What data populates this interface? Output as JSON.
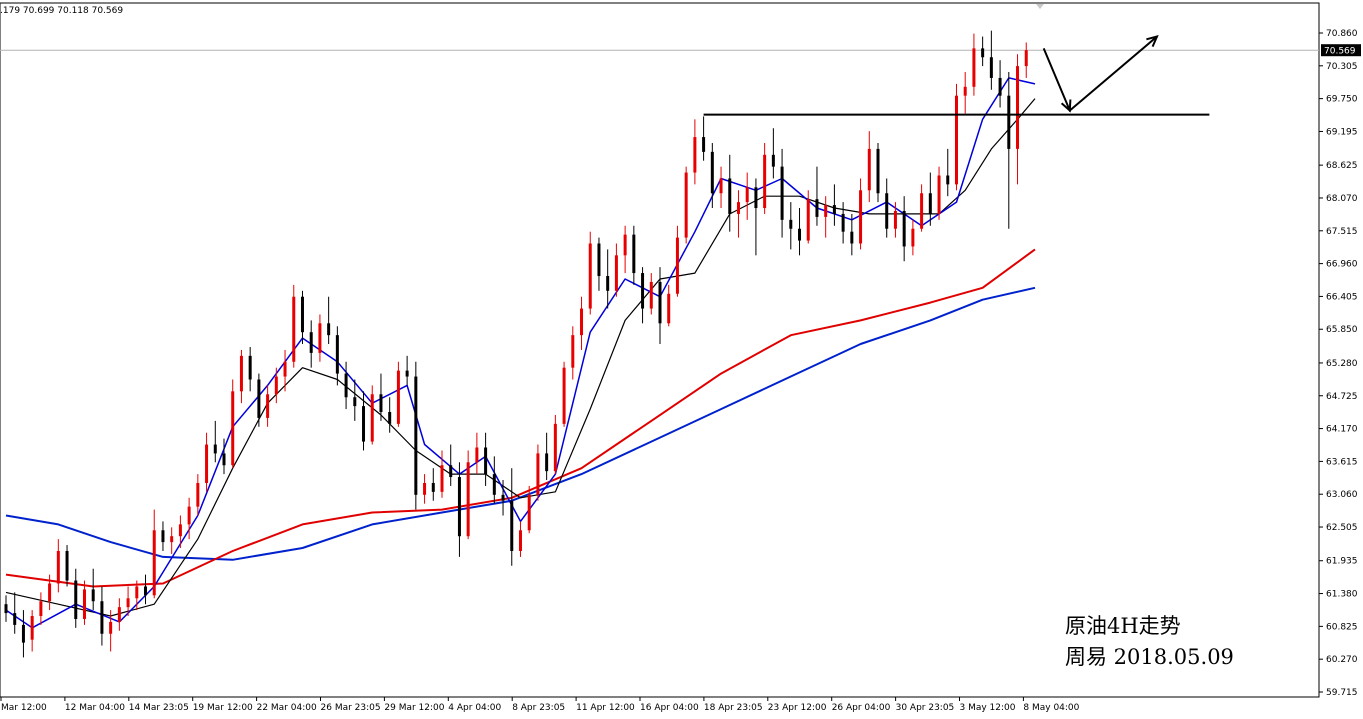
{
  "header": {
    "ohlc_text": ".179 70.699 70.118 70.569"
  },
  "annotation": {
    "title": "原油4H走势",
    "date_line": "周易 2018.05.09"
  },
  "colors": {
    "bull": "#e80000",
    "bear": "#000000",
    "ma_fast": "#0000dd",
    "ma_mid": "#000000",
    "ma_slow_red": "#e00000",
    "ma_slow_blue": "#0022cc",
    "price_line": "#b4b4b4",
    "badge": "#000000"
  },
  "chart_data": {
    "type": "candlestick",
    "y_ticks": [
      "70.860",
      "70.305",
      "69.750",
      "69.195",
      "68.625",
      "68.070",
      "67.515",
      "66.960",
      "66.405",
      "65.850",
      "65.280",
      "64.725",
      "64.170",
      "63.615",
      "63.060",
      "62.505",
      "61.935",
      "61.380",
      "60.825",
      "60.270",
      "59.715"
    ],
    "ylim": [
      59.715,
      70.86
    ],
    "x_ticks": [
      "Mar 12:00",
      "12 Mar 04:00",
      "14 Mar 23:05",
      "19 Mar 12:00",
      "22 Mar 04:00",
      "26 Mar 23:05",
      "29 Mar 12:00",
      "4 Apr 04:00",
      "8 Apr 23:05",
      "11 Apr 12:00",
      "16 Apr 04:00",
      "18 Apr 23:05",
      "23 Apr 12:00",
      "26 Apr 04:00",
      "30 Apr 23:05",
      "3 May 12:00",
      "8 May 04:00"
    ],
    "current_price": 70.569,
    "candles": [
      {
        "o": 61.2,
        "h": 61.35,
        "l": 60.9,
        "c": 61.05
      },
      {
        "o": 61.05,
        "h": 61.4,
        "l": 60.7,
        "c": 60.85
      },
      {
        "o": 60.85,
        "h": 61.1,
        "l": 60.3,
        "c": 60.55
      },
      {
        "o": 60.6,
        "h": 61.1,
        "l": 60.4,
        "c": 61.0
      },
      {
        "o": 61.0,
        "h": 61.4,
        "l": 60.85,
        "c": 61.25
      },
      {
        "o": 61.25,
        "h": 61.7,
        "l": 61.1,
        "c": 61.55
      },
      {
        "o": 61.55,
        "h": 62.3,
        "l": 61.4,
        "c": 62.1
      },
      {
        "o": 62.1,
        "h": 62.2,
        "l": 61.5,
        "c": 61.6
      },
      {
        "o": 61.6,
        "h": 61.8,
        "l": 60.8,
        "c": 60.95
      },
      {
        "o": 60.95,
        "h": 61.6,
        "l": 60.85,
        "c": 61.45
      },
      {
        "o": 61.45,
        "h": 61.8,
        "l": 61.1,
        "c": 61.25
      },
      {
        "o": 61.25,
        "h": 61.5,
        "l": 60.5,
        "c": 60.7
      },
      {
        "o": 60.7,
        "h": 61.1,
        "l": 60.4,
        "c": 60.9
      },
      {
        "o": 60.9,
        "h": 61.3,
        "l": 60.75,
        "c": 61.15
      },
      {
        "o": 61.15,
        "h": 61.5,
        "l": 61.0,
        "c": 61.3
      },
      {
        "o": 61.3,
        "h": 61.6,
        "l": 61.1,
        "c": 61.5
      },
      {
        "o": 61.5,
        "h": 61.7,
        "l": 61.2,
        "c": 61.35
      },
      {
        "o": 61.35,
        "h": 62.8,
        "l": 61.3,
        "c": 62.45
      },
      {
        "o": 62.45,
        "h": 62.6,
        "l": 62.1,
        "c": 62.25
      },
      {
        "o": 62.25,
        "h": 62.5,
        "l": 62.05,
        "c": 62.35
      },
      {
        "o": 62.35,
        "h": 62.7,
        "l": 62.15,
        "c": 62.55
      },
      {
        "o": 62.55,
        "h": 63.0,
        "l": 62.3,
        "c": 62.85
      },
      {
        "o": 62.85,
        "h": 63.4,
        "l": 62.7,
        "c": 63.25
      },
      {
        "o": 63.25,
        "h": 64.1,
        "l": 63.1,
        "c": 63.9
      },
      {
        "o": 63.9,
        "h": 64.3,
        "l": 63.6,
        "c": 63.75
      },
      {
        "o": 63.75,
        "h": 64.0,
        "l": 63.4,
        "c": 63.55
      },
      {
        "o": 63.55,
        "h": 65.0,
        "l": 63.5,
        "c": 64.8
      },
      {
        "o": 64.8,
        "h": 65.5,
        "l": 64.6,
        "c": 65.4
      },
      {
        "o": 65.4,
        "h": 65.55,
        "l": 64.8,
        "c": 65.0
      },
      {
        "o": 65.0,
        "h": 65.1,
        "l": 64.2,
        "c": 64.35
      },
      {
        "o": 64.35,
        "h": 64.9,
        "l": 64.2,
        "c": 64.75
      },
      {
        "o": 64.75,
        "h": 65.2,
        "l": 64.6,
        "c": 65.05
      },
      {
        "o": 65.05,
        "h": 65.5,
        "l": 64.8,
        "c": 65.3
      },
      {
        "o": 65.3,
        "h": 66.6,
        "l": 65.2,
        "c": 66.4
      },
      {
        "o": 66.4,
        "h": 66.5,
        "l": 65.6,
        "c": 65.8
      },
      {
        "o": 65.8,
        "h": 66.0,
        "l": 65.2,
        "c": 65.45
      },
      {
        "o": 65.45,
        "h": 66.1,
        "l": 65.3,
        "c": 65.95
      },
      {
        "o": 65.95,
        "h": 66.4,
        "l": 65.6,
        "c": 65.75
      },
      {
        "o": 65.75,
        "h": 65.9,
        "l": 64.9,
        "c": 65.1
      },
      {
        "o": 65.1,
        "h": 65.3,
        "l": 64.5,
        "c": 64.7
      },
      {
        "o": 64.7,
        "h": 65.0,
        "l": 64.3,
        "c": 64.55
      },
      {
        "o": 64.55,
        "h": 64.8,
        "l": 63.8,
        "c": 63.95
      },
      {
        "o": 63.95,
        "h": 64.9,
        "l": 63.9,
        "c": 64.75
      },
      {
        "o": 64.75,
        "h": 65.1,
        "l": 64.3,
        "c": 64.45
      },
      {
        "o": 64.45,
        "h": 64.7,
        "l": 64.1,
        "c": 64.25
      },
      {
        "o": 64.25,
        "h": 65.3,
        "l": 64.2,
        "c": 65.15
      },
      {
        "o": 65.15,
        "h": 65.4,
        "l": 64.9,
        "c": 65.05
      },
      {
        "o": 65.05,
        "h": 65.3,
        "l": 62.8,
        "c": 63.05
      },
      {
        "o": 63.05,
        "h": 63.4,
        "l": 62.9,
        "c": 63.25
      },
      {
        "o": 63.25,
        "h": 63.5,
        "l": 62.95,
        "c": 63.1
      },
      {
        "o": 63.1,
        "h": 63.8,
        "l": 63.0,
        "c": 63.55
      },
      {
        "o": 63.55,
        "h": 63.9,
        "l": 63.2,
        "c": 63.35
      },
      {
        "o": 63.35,
        "h": 63.6,
        "l": 62.0,
        "c": 62.35
      },
      {
        "o": 62.35,
        "h": 63.8,
        "l": 62.3,
        "c": 63.6
      },
      {
        "o": 63.6,
        "h": 64.1,
        "l": 63.4,
        "c": 63.85
      },
      {
        "o": 63.85,
        "h": 64.1,
        "l": 63.2,
        "c": 63.4
      },
      {
        "o": 63.4,
        "h": 63.7,
        "l": 62.9,
        "c": 63.05
      },
      {
        "o": 63.05,
        "h": 63.3,
        "l": 62.7,
        "c": 62.95
      },
      {
        "o": 62.95,
        "h": 63.5,
        "l": 61.85,
        "c": 62.1
      },
      {
        "o": 62.1,
        "h": 62.6,
        "l": 62.0,
        "c": 62.45
      },
      {
        "o": 62.45,
        "h": 63.2,
        "l": 62.4,
        "c": 63.05
      },
      {
        "o": 63.05,
        "h": 63.9,
        "l": 62.95,
        "c": 63.75
      },
      {
        "o": 63.75,
        "h": 64.1,
        "l": 63.3,
        "c": 63.45
      },
      {
        "o": 63.45,
        "h": 64.4,
        "l": 63.4,
        "c": 64.25
      },
      {
        "o": 64.25,
        "h": 65.3,
        "l": 64.2,
        "c": 65.2
      },
      {
        "o": 65.2,
        "h": 65.9,
        "l": 65.0,
        "c": 65.75
      },
      {
        "o": 65.75,
        "h": 66.4,
        "l": 65.5,
        "c": 66.2
      },
      {
        "o": 66.2,
        "h": 67.5,
        "l": 66.1,
        "c": 67.3
      },
      {
        "o": 67.3,
        "h": 67.4,
        "l": 66.5,
        "c": 66.75
      },
      {
        "o": 66.75,
        "h": 67.2,
        "l": 66.2,
        "c": 66.5
      },
      {
        "o": 66.5,
        "h": 67.3,
        "l": 66.4,
        "c": 67.1
      },
      {
        "o": 67.1,
        "h": 67.6,
        "l": 66.8,
        "c": 67.45
      },
      {
        "o": 67.45,
        "h": 67.6,
        "l": 66.6,
        "c": 66.8
      },
      {
        "o": 66.8,
        "h": 66.9,
        "l": 65.95,
        "c": 66.2
      },
      {
        "o": 66.2,
        "h": 66.8,
        "l": 66.1,
        "c": 66.65
      },
      {
        "o": 66.65,
        "h": 66.9,
        "l": 65.6,
        "c": 65.95
      },
      {
        "o": 65.95,
        "h": 66.6,
        "l": 65.9,
        "c": 66.45
      },
      {
        "o": 66.45,
        "h": 67.6,
        "l": 66.4,
        "c": 67.4
      },
      {
        "o": 67.4,
        "h": 68.6,
        "l": 67.3,
        "c": 68.5
      },
      {
        "o": 68.5,
        "h": 69.4,
        "l": 68.3,
        "c": 69.1
      },
      {
        "o": 69.1,
        "h": 69.45,
        "l": 68.7,
        "c": 68.85
      },
      {
        "o": 68.85,
        "h": 69.0,
        "l": 67.9,
        "c": 68.15
      },
      {
        "o": 68.15,
        "h": 68.6,
        "l": 67.9,
        "c": 68.4
      },
      {
        "o": 68.4,
        "h": 68.8,
        "l": 67.5,
        "c": 67.8
      },
      {
        "o": 67.8,
        "h": 68.2,
        "l": 67.4,
        "c": 68.0
      },
      {
        "o": 68.0,
        "h": 68.5,
        "l": 67.7,
        "c": 68.25
      },
      {
        "o": 68.25,
        "h": 68.4,
        "l": 67.1,
        "c": 67.9
      },
      {
        "o": 67.9,
        "h": 69.0,
        "l": 67.8,
        "c": 68.8
      },
      {
        "o": 68.8,
        "h": 69.25,
        "l": 68.4,
        "c": 68.6
      },
      {
        "o": 68.6,
        "h": 68.9,
        "l": 67.4,
        "c": 67.7
      },
      {
        "o": 67.7,
        "h": 68.0,
        "l": 67.2,
        "c": 67.55
      },
      {
        "o": 67.55,
        "h": 67.9,
        "l": 67.1,
        "c": 67.35
      },
      {
        "o": 67.35,
        "h": 68.2,
        "l": 67.3,
        "c": 68.05
      },
      {
        "o": 68.05,
        "h": 68.6,
        "l": 67.6,
        "c": 67.75
      },
      {
        "o": 67.75,
        "h": 68.1,
        "l": 67.4,
        "c": 67.95
      },
      {
        "o": 67.95,
        "h": 68.3,
        "l": 67.6,
        "c": 67.8
      },
      {
        "o": 67.8,
        "h": 68.0,
        "l": 67.3,
        "c": 67.5
      },
      {
        "o": 67.5,
        "h": 67.8,
        "l": 67.1,
        "c": 67.3
      },
      {
        "o": 67.3,
        "h": 68.4,
        "l": 67.2,
        "c": 68.2
      },
      {
        "o": 68.2,
        "h": 69.2,
        "l": 68.0,
        "c": 68.9
      },
      {
        "o": 68.9,
        "h": 69.0,
        "l": 68.0,
        "c": 68.15
      },
      {
        "o": 68.15,
        "h": 68.4,
        "l": 67.4,
        "c": 67.55
      },
      {
        "o": 67.55,
        "h": 68.0,
        "l": 67.4,
        "c": 67.85
      },
      {
        "o": 67.85,
        "h": 68.1,
        "l": 67.0,
        "c": 67.25
      },
      {
        "o": 67.25,
        "h": 67.7,
        "l": 67.1,
        "c": 67.55
      },
      {
        "o": 67.55,
        "h": 68.3,
        "l": 67.5,
        "c": 68.15
      },
      {
        "o": 68.15,
        "h": 68.5,
        "l": 67.6,
        "c": 67.8
      },
      {
        "o": 67.8,
        "h": 68.6,
        "l": 67.7,
        "c": 68.45
      },
      {
        "o": 68.45,
        "h": 68.9,
        "l": 68.1,
        "c": 68.3
      },
      {
        "o": 68.3,
        "h": 70.0,
        "l": 68.2,
        "c": 69.8
      },
      {
        "o": 69.8,
        "h": 70.2,
        "l": 69.5,
        "c": 69.95
      },
      {
        "o": 69.95,
        "h": 70.85,
        "l": 69.8,
        "c": 70.6
      },
      {
        "o": 70.6,
        "h": 70.8,
        "l": 70.3,
        "c": 70.45
      },
      {
        "o": 70.45,
        "h": 70.9,
        "l": 69.9,
        "c": 70.1
      },
      {
        "o": 70.1,
        "h": 70.4,
        "l": 69.6,
        "c": 69.8
      },
      {
        "o": 69.8,
        "h": 70.2,
        "l": 67.55,
        "c": 68.9
      },
      {
        "o": 68.9,
        "h": 70.5,
        "l": 68.3,
        "c": 70.3
      },
      {
        "o": 70.3,
        "h": 70.7,
        "l": 70.1,
        "c": 70.57
      }
    ],
    "ma_fast": [
      [
        0,
        61.1
      ],
      [
        3,
        60.8
      ],
      [
        8,
        61.2
      ],
      [
        13,
        60.9
      ],
      [
        17,
        61.5
      ],
      [
        22,
        62.7
      ],
      [
        26,
        64.2
      ],
      [
        30,
        64.9
      ],
      [
        34,
        65.7
      ],
      [
        38,
        65.3
      ],
      [
        42,
        64.6
      ],
      [
        46,
        64.9
      ],
      [
        48,
        63.9
      ],
      [
        52,
        63.4
      ],
      [
        55,
        63.7
      ],
      [
        59,
        62.6
      ],
      [
        63,
        63.4
      ],
      [
        67,
        65.8
      ],
      [
        71,
        66.7
      ],
      [
        75,
        66.4
      ],
      [
        79,
        67.5
      ],
      [
        82,
        68.4
      ],
      [
        86,
        68.2
      ],
      [
        89,
        68.4
      ],
      [
        93,
        67.9
      ],
      [
        97,
        67.7
      ],
      [
        101,
        68.0
      ],
      [
        105,
        67.6
      ],
      [
        109,
        68.0
      ],
      [
        112,
        69.4
      ],
      [
        115,
        70.1
      ],
      [
        118,
        70.0
      ]
    ],
    "ma_mid": [
      [
        0,
        61.4
      ],
      [
        6,
        61.2
      ],
      [
        12,
        61.0
      ],
      [
        17,
        61.2
      ],
      [
        22,
        62.3
      ],
      [
        26,
        63.5
      ],
      [
        30,
        64.6
      ],
      [
        34,
        65.2
      ],
      [
        38,
        65.0
      ],
      [
        43,
        64.4
      ],
      [
        47,
        63.8
      ],
      [
        51,
        63.4
      ],
      [
        55,
        63.4
      ],
      [
        59,
        63.0
      ],
      [
        63,
        63.1
      ],
      [
        67,
        64.5
      ],
      [
        71,
        66.0
      ],
      [
        75,
        66.7
      ],
      [
        79,
        66.8
      ],
      [
        83,
        67.8
      ],
      [
        87,
        68.1
      ],
      [
        91,
        68.1
      ],
      [
        95,
        67.9
      ],
      [
        99,
        67.8
      ],
      [
        103,
        67.8
      ],
      [
        107,
        67.8
      ],
      [
        110,
        68.2
      ],
      [
        113,
        68.9
      ],
      [
        116,
        69.4
      ],
      [
        118,
        69.75
      ]
    ],
    "ma_slow_red": [
      [
        0,
        61.7
      ],
      [
        10,
        61.5
      ],
      [
        18,
        61.55
      ],
      [
        26,
        62.1
      ],
      [
        34,
        62.55
      ],
      [
        42,
        62.75
      ],
      [
        50,
        62.8
      ],
      [
        58,
        63.0
      ],
      [
        66,
        63.5
      ],
      [
        74,
        64.3
      ],
      [
        82,
        65.1
      ],
      [
        90,
        65.75
      ],
      [
        98,
        66.0
      ],
      [
        106,
        66.3
      ],
      [
        112,
        66.55
      ],
      [
        118,
        67.2
      ]
    ],
    "ma_slow_blue": [
      [
        0,
        62.7
      ],
      [
        6,
        62.55
      ],
      [
        12,
        62.25
      ],
      [
        18,
        62.0
      ],
      [
        26,
        61.95
      ],
      [
        34,
        62.15
      ],
      [
        42,
        62.55
      ],
      [
        50,
        62.75
      ],
      [
        58,
        62.95
      ],
      [
        66,
        63.4
      ],
      [
        74,
        63.95
      ],
      [
        82,
        64.5
      ],
      [
        90,
        65.05
      ],
      [
        98,
        65.6
      ],
      [
        106,
        66.0
      ],
      [
        112,
        66.35
      ],
      [
        118,
        66.55
      ]
    ],
    "resistance": {
      "value": 69.48,
      "from_index": 80,
      "to_index": 138
    },
    "forecast_path": [
      [
        119,
        70.6
      ],
      [
        122,
        69.55
      ],
      [
        132,
        70.8
      ]
    ]
  }
}
